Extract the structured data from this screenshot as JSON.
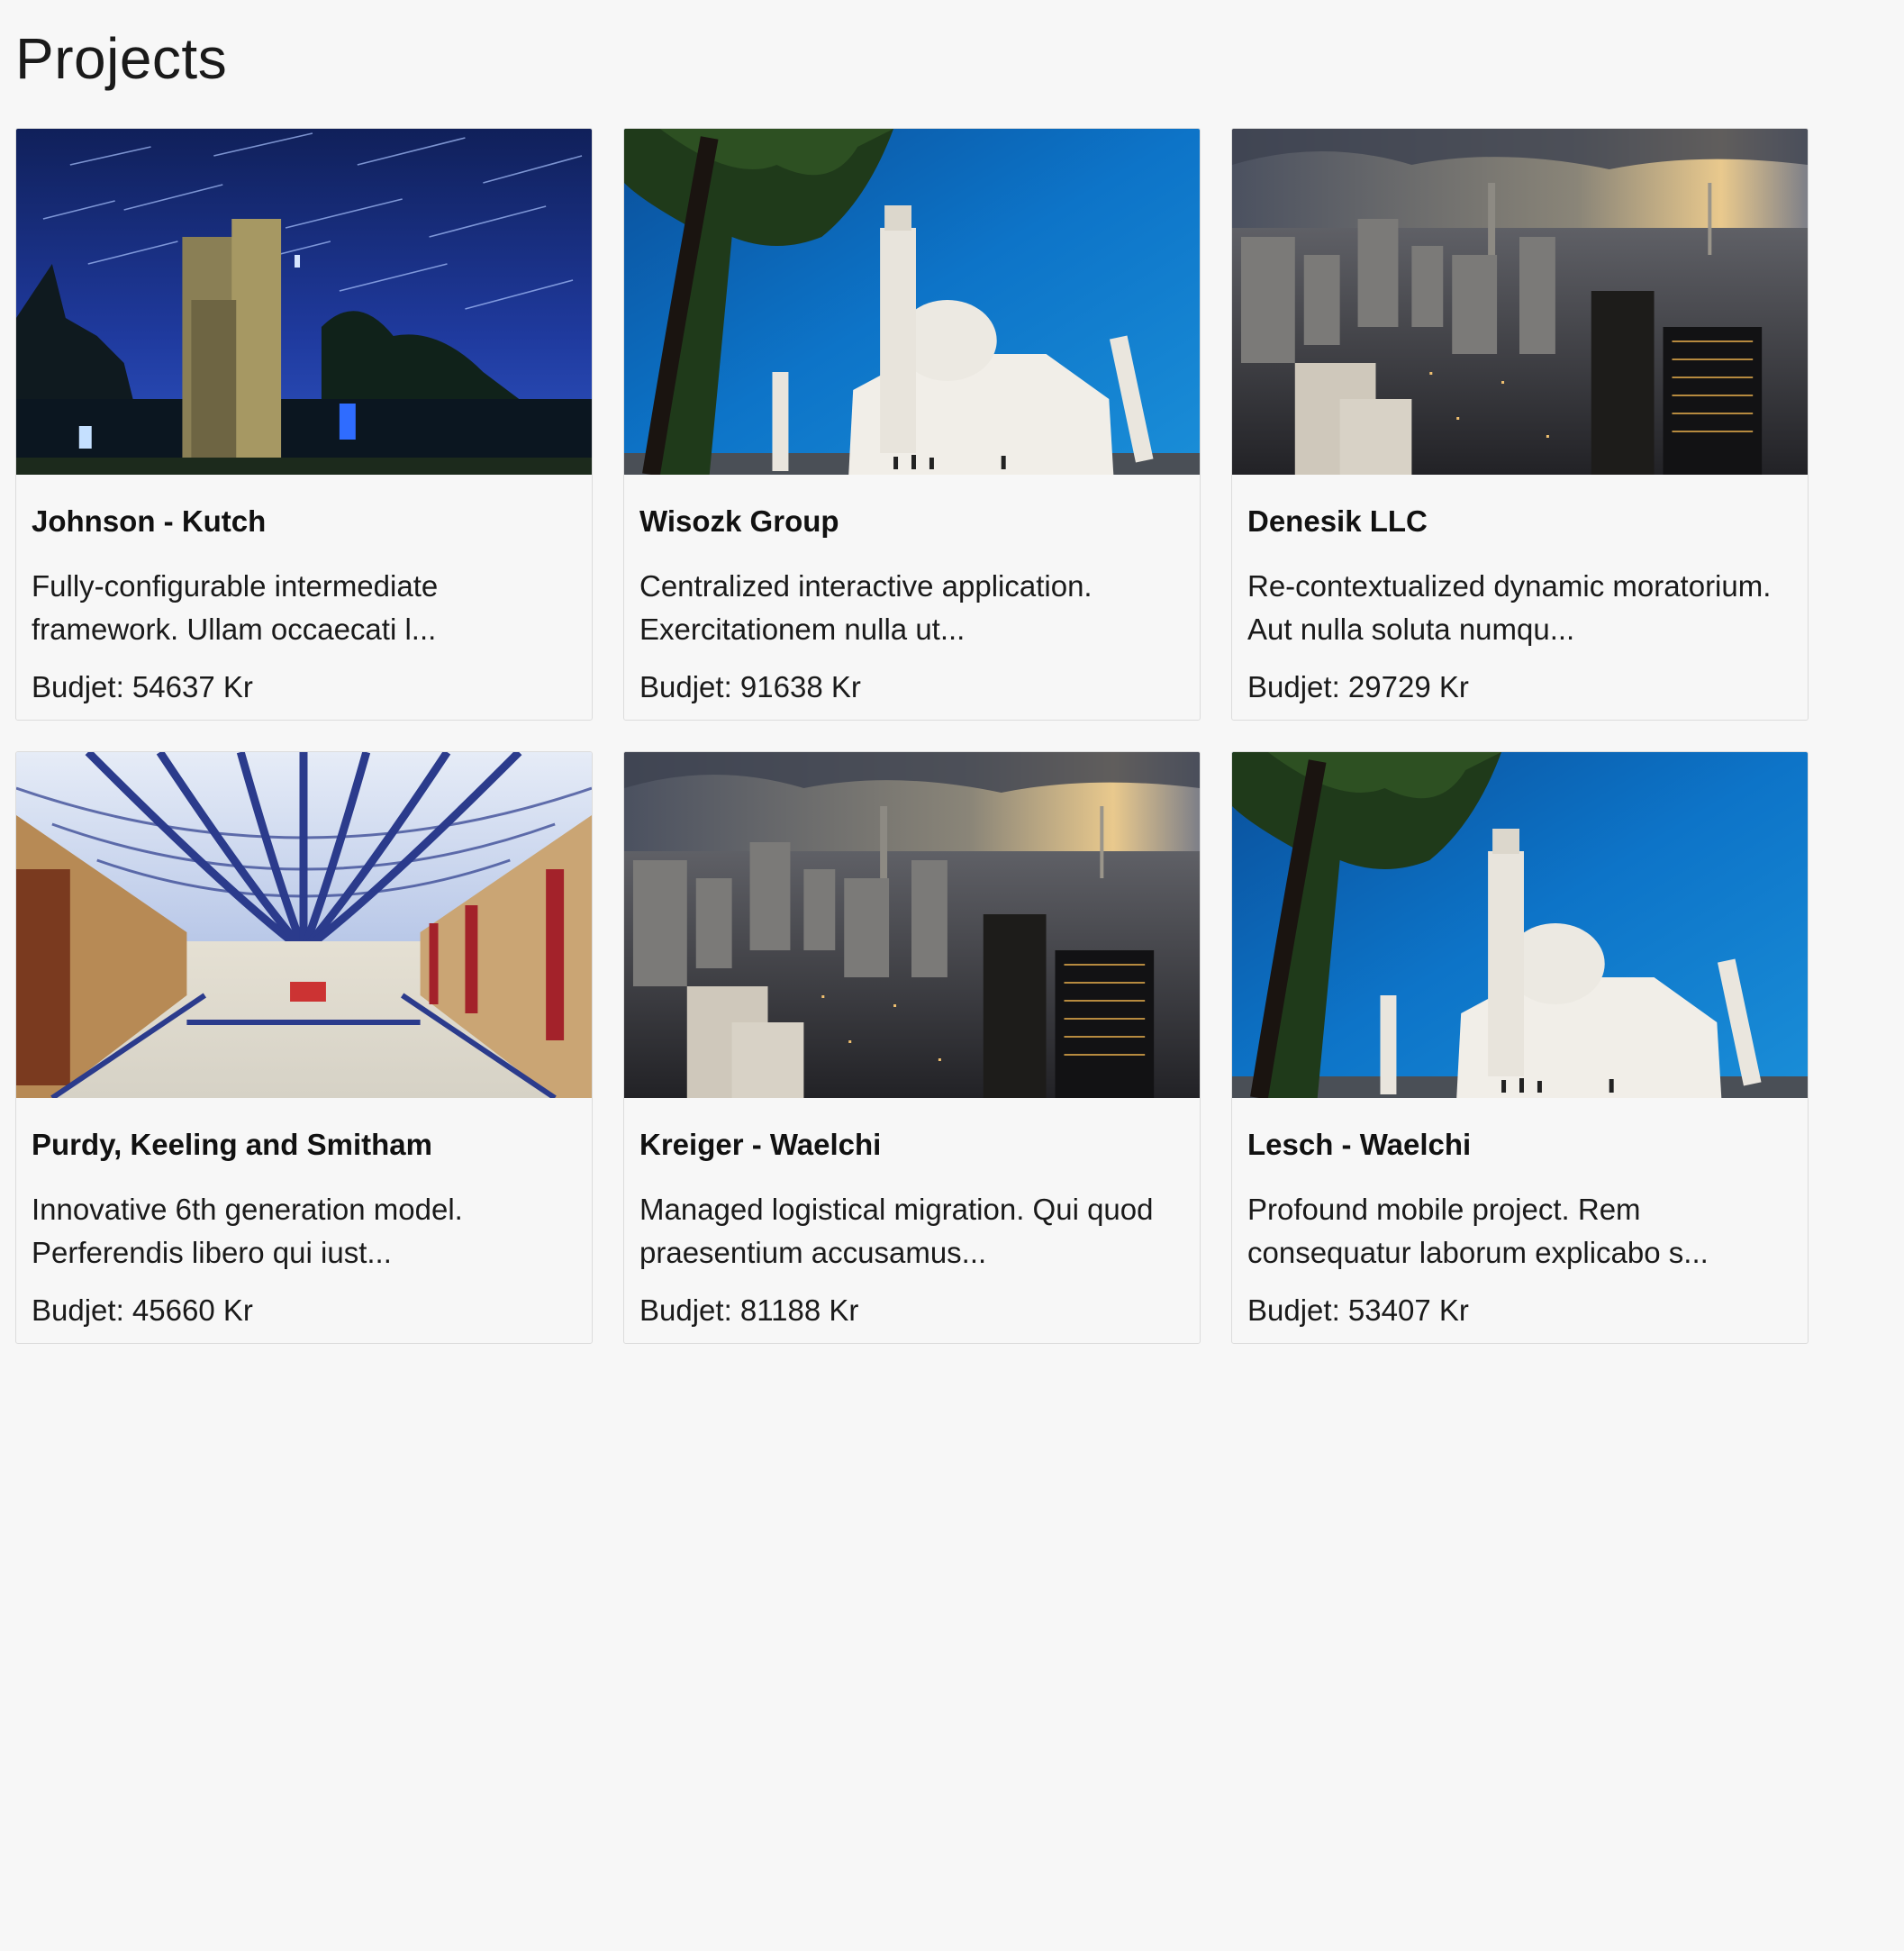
{
  "page": {
    "title": "Projects"
  },
  "projects": [
    {
      "name": "Johnson - Kutch",
      "description": "Fully-configurable intermediate framework. Ullam occaecati l...",
      "budget": "Budjet: 54637 Kr",
      "image": "night-sky-star-trails-tower"
    },
    {
      "name": "Wisozk Group",
      "description": "Centralized interactive application. Exercitationem nulla ut...",
      "budget": "Budjet: 91638 Kr",
      "image": "taj-mahal-blue-sky"
    },
    {
      "name": "Denesik LLC",
      "description": "Re-contextualized dynamic moratorium. Aut nulla soluta numqu...",
      "budget": "Budjet: 29729 Kr",
      "image": "city-skyline-aerial"
    },
    {
      "name": "Purdy, Keeling and Smitham",
      "description": "Innovative 6th generation model. Perferendis libero qui iust...",
      "budget": "Budjet: 45660 Kr",
      "image": "glass-roof-arcade-hall"
    },
    {
      "name": "Kreiger - Waelchi",
      "description": "Managed logistical migration. Qui quod praesentium accusamus...",
      "budget": "Budjet: 81188 Kr",
      "image": "city-skyline-aerial"
    },
    {
      "name": "Lesch - Waelchi",
      "description": "Profound mobile project. Rem consequatur laborum explicabo s...",
      "budget": "Budjet: 53407 Kr",
      "image": "taj-mahal-blue-sky"
    }
  ]
}
